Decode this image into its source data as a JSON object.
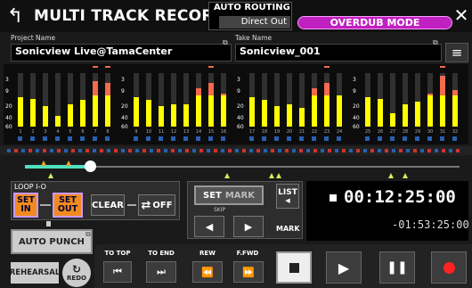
{
  "header": {
    "title": "MULTI TRACK RECORDER",
    "auto_routing_label": "AUTO ROUTING",
    "auto_routing_value": "Direct Out",
    "mode_label": "OVERDUB MODE"
  },
  "project": {
    "label": "Project Name",
    "value": "Sonicview Live@TamaCenter"
  },
  "take": {
    "label": "Take Name",
    "value": "Sonicview_001"
  },
  "meters": {
    "scale": [
      "3",
      "9",
      "20",
      "40",
      "60"
    ],
    "tracks": [
      "1",
      "2",
      "3",
      "4",
      "5",
      "6",
      "7",
      "8",
      "9",
      "10",
      "11",
      "12",
      "13",
      "14",
      "15",
      "16",
      "17",
      "18",
      "19",
      "20",
      "21",
      "22",
      "23",
      "24",
      "25",
      "26",
      "27",
      "28",
      "29",
      "30",
      "31",
      "32"
    ],
    "levels": [
      0.55,
      0.52,
      0.38,
      0.2,
      0.42,
      0.5,
      0.85,
      0.82,
      0.55,
      0.5,
      0.38,
      0.42,
      0.42,
      0.72,
      0.82,
      0.62,
      0.55,
      0.5,
      0.38,
      0.42,
      0.35,
      0.72,
      0.82,
      0.58,
      0.55,
      0.52,
      0.25,
      0.42,
      0.46,
      0.62,
      0.95,
      0.68
    ],
    "colors": {
      "signal": "#ffff00",
      "over": "#f26a4f",
      "record_ready": "#2a5fb0"
    }
  },
  "loop": {
    "label": "LOOP I-O",
    "set_in": [
      "SET",
      "IN"
    ],
    "set_out": [
      "SET",
      "OUT"
    ],
    "clear": "CLEAR",
    "off": "OFF"
  },
  "auto_punch": "AUTO PUNCH",
  "rehearsal": "REHEARSAL",
  "redo": "REDO",
  "mark_panel": {
    "set_mark": [
      "SET",
      "MARK"
    ],
    "skip": "SKIP",
    "list": "LIST",
    "mark": "MARK"
  },
  "counter": {
    "main": "00:12:25:00",
    "remain": "-01:53:25:00"
  },
  "transport": {
    "to_top": "TO TOP",
    "to_end": "TO END",
    "rew": "REW",
    "ffwd": "F.FWD"
  },
  "position": {
    "fraction": 0.15
  }
}
